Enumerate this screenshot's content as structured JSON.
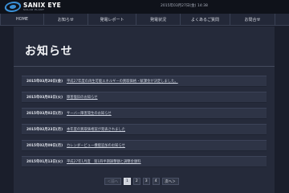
{
  "header": {
    "logo_name": "SANIX EYE",
    "logo_sub": "SOLAR PLANT",
    "datetime": "2015年03月27日(金) 14:38"
  },
  "nav": {
    "items": [
      {
        "label": "HOME"
      },
      {
        "label": "お知らせ"
      },
      {
        "label": "発電レポート"
      },
      {
        "label": "発電状況"
      },
      {
        "label": "よくあるご質問"
      },
      {
        "label": "お問合せ"
      }
    ]
  },
  "page": {
    "title": "お知らせ"
  },
  "news": [
    {
      "date": "2015年03月20日(金)",
      "title": "平成27年度の再生可能エネルギーの買取価格・賦課金が決定しました。"
    },
    {
      "date": "2015年03月03日(火)",
      "title": "障害復旧のお知らせ"
    },
    {
      "date": "2015年03月02日(月)",
      "title": "サーバー障害発生のお知らせ"
    },
    {
      "date": "2015年02月23日(月)",
      "title": "本年度の買取価格案が発表されました"
    },
    {
      "date": "2015年02月09日(月)",
      "title": "カレンダービュー機能追加のお知らせ"
    },
    {
      "date": "2015年01月13日(火)",
      "title": "平成27年1月度　第1四半期調整額と調整金額料"
    }
  ],
  "pagination": {
    "prev": "＜前へ",
    "pages": [
      "1",
      "2",
      "3",
      "4"
    ],
    "current": "1",
    "next": "次へ＞"
  }
}
